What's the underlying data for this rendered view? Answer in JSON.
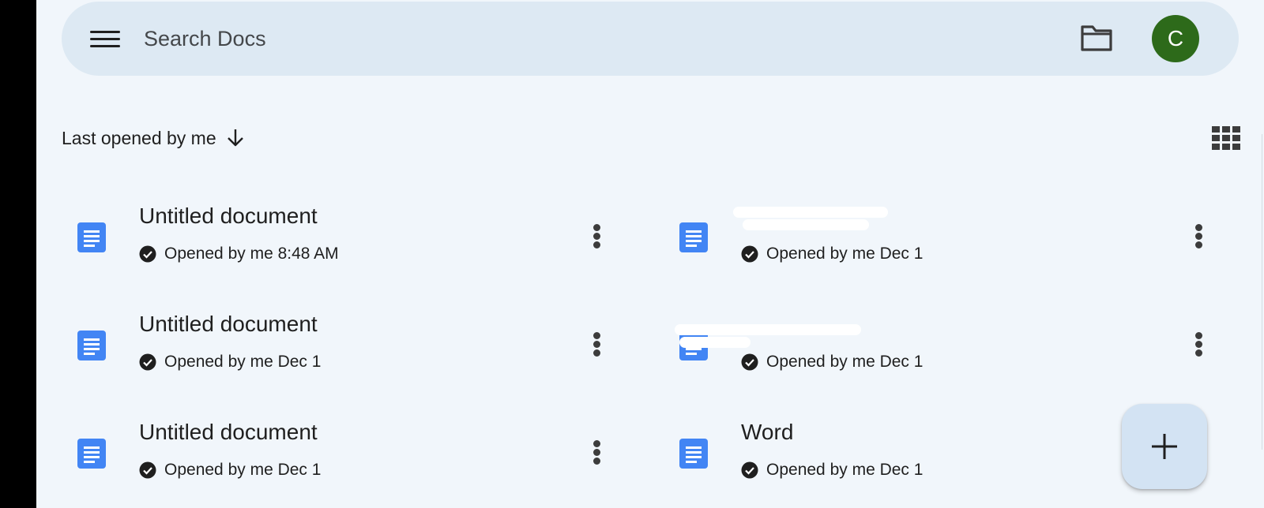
{
  "search": {
    "placeholder": "Search Docs"
  },
  "account": {
    "initial": "C",
    "avatar_color": "#2d6a1a"
  },
  "sort": {
    "label": "Last opened by me",
    "direction": "descending"
  },
  "view": {
    "mode_icon": "grid-view-icon"
  },
  "documents": [
    {
      "title": "Untitled document",
      "subtitle": "Opened by me 8:48 AM"
    },
    {
      "title": "",
      "subtitle": "Opened by me Dec 1"
    },
    {
      "title": "Untitled document",
      "subtitle": "Opened by me Dec 1"
    },
    {
      "title": "",
      "subtitle": "Opened by me Dec 1"
    },
    {
      "title": "Untitled document",
      "subtitle": "Opened by me Dec 1"
    },
    {
      "title": "Word",
      "subtitle": "Opened by me Dec 1"
    }
  ],
  "colors": {
    "accent": "#4285f4",
    "background": "#f1f6fb",
    "search_bg": "#dde9f3",
    "fab_bg": "#d3e3f3"
  },
  "icons": {
    "menu": "hamburger-menu-icon",
    "folder": "folder-icon",
    "doc": "google-docs-icon",
    "check": "check-circle-icon",
    "more": "more-vert-icon",
    "fab": "plus-icon"
  }
}
